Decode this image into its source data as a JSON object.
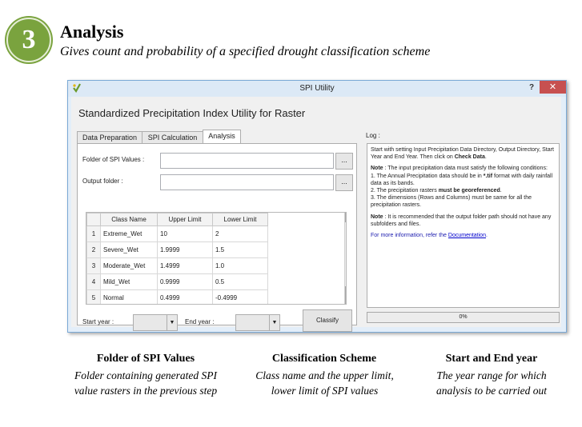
{
  "header": {
    "step_number": "3",
    "title": "Analysis",
    "subtitle": "Gives count and probability of a specified drought classification scheme"
  },
  "window": {
    "title": "SPI Utility",
    "help_label": "?",
    "close_label": "✕",
    "app_heading": "Standardized Precipitation Index Utility for Raster",
    "tabs": [
      {
        "label": "Data Preparation"
      },
      {
        "label": "SPI Calculation"
      },
      {
        "label": "Analysis"
      }
    ],
    "active_tab": "Analysis",
    "form": {
      "folder_label": "Folder of SPI Values :",
      "folder_value": "",
      "output_label": "Output folder :",
      "output_value": "",
      "browse_label": "...",
      "start_year_label": "Start year :",
      "start_year_value": "",
      "end_year_label": "End year :",
      "end_year_value": "",
      "classify_label": "Classify"
    },
    "table": {
      "columns": [
        "Class Name",
        "Upper Limit",
        "Lower Limit"
      ],
      "rows": [
        {
          "num": "1",
          "name": "Extreme_Wet",
          "upper": "10",
          "lower": "2"
        },
        {
          "num": "2",
          "name": "Severe_Wet",
          "upper": "1.9999",
          "lower": "1.5"
        },
        {
          "num": "3",
          "name": "Moderate_Wet",
          "upper": "1.4999",
          "lower": "1.0"
        },
        {
          "num": "4",
          "name": "Mild_Wet",
          "upper": "0.9999",
          "lower": "0.5"
        },
        {
          "num": "5",
          "name": "Normal",
          "upper": "0.4999",
          "lower": "-0.4999"
        }
      ]
    },
    "log": {
      "label": "Log :",
      "p1": "Start with setting Input Precipitation Data Directory, Output Directory, Start Year and End Year. Then click on",
      "p1_bold": "Check Data",
      "note_label": "Note",
      "note1_text": ": The input precipitation data must satisfy the following conditions:",
      "cond1_a": "1. The Annual Precipitation data should be in",
      "cond1_bold": "*.tif",
      "cond1_b": "format with daily rainfall data as its bands.",
      "cond2_a": "2. The precipitation rasters",
      "cond2_bold": "must be georeferenced",
      "cond3": "3. The dimensions (Rows and Columns) must be same for all the precipitation rasters.",
      "note2_text": ": It is recommended that the output folder path should not have any subfolders and files.",
      "more_info": "For more information, refer the",
      "doc_link": "Documentation"
    },
    "progress_text": "0%"
  },
  "captions": [
    {
      "title": "Folder of SPI Values",
      "body": "Folder containing generated SPI value rasters in the previous step"
    },
    {
      "title": "Classification Scheme",
      "body": "Class name and the upper limit, lower limit of SPI values"
    },
    {
      "title": "Start and End year",
      "body": "The year range for which analysis to be carried out"
    }
  ],
  "colors": {
    "step_circle": "#7aa33e",
    "close_button": "#c75050",
    "window_border": "#7aa9d6"
  }
}
